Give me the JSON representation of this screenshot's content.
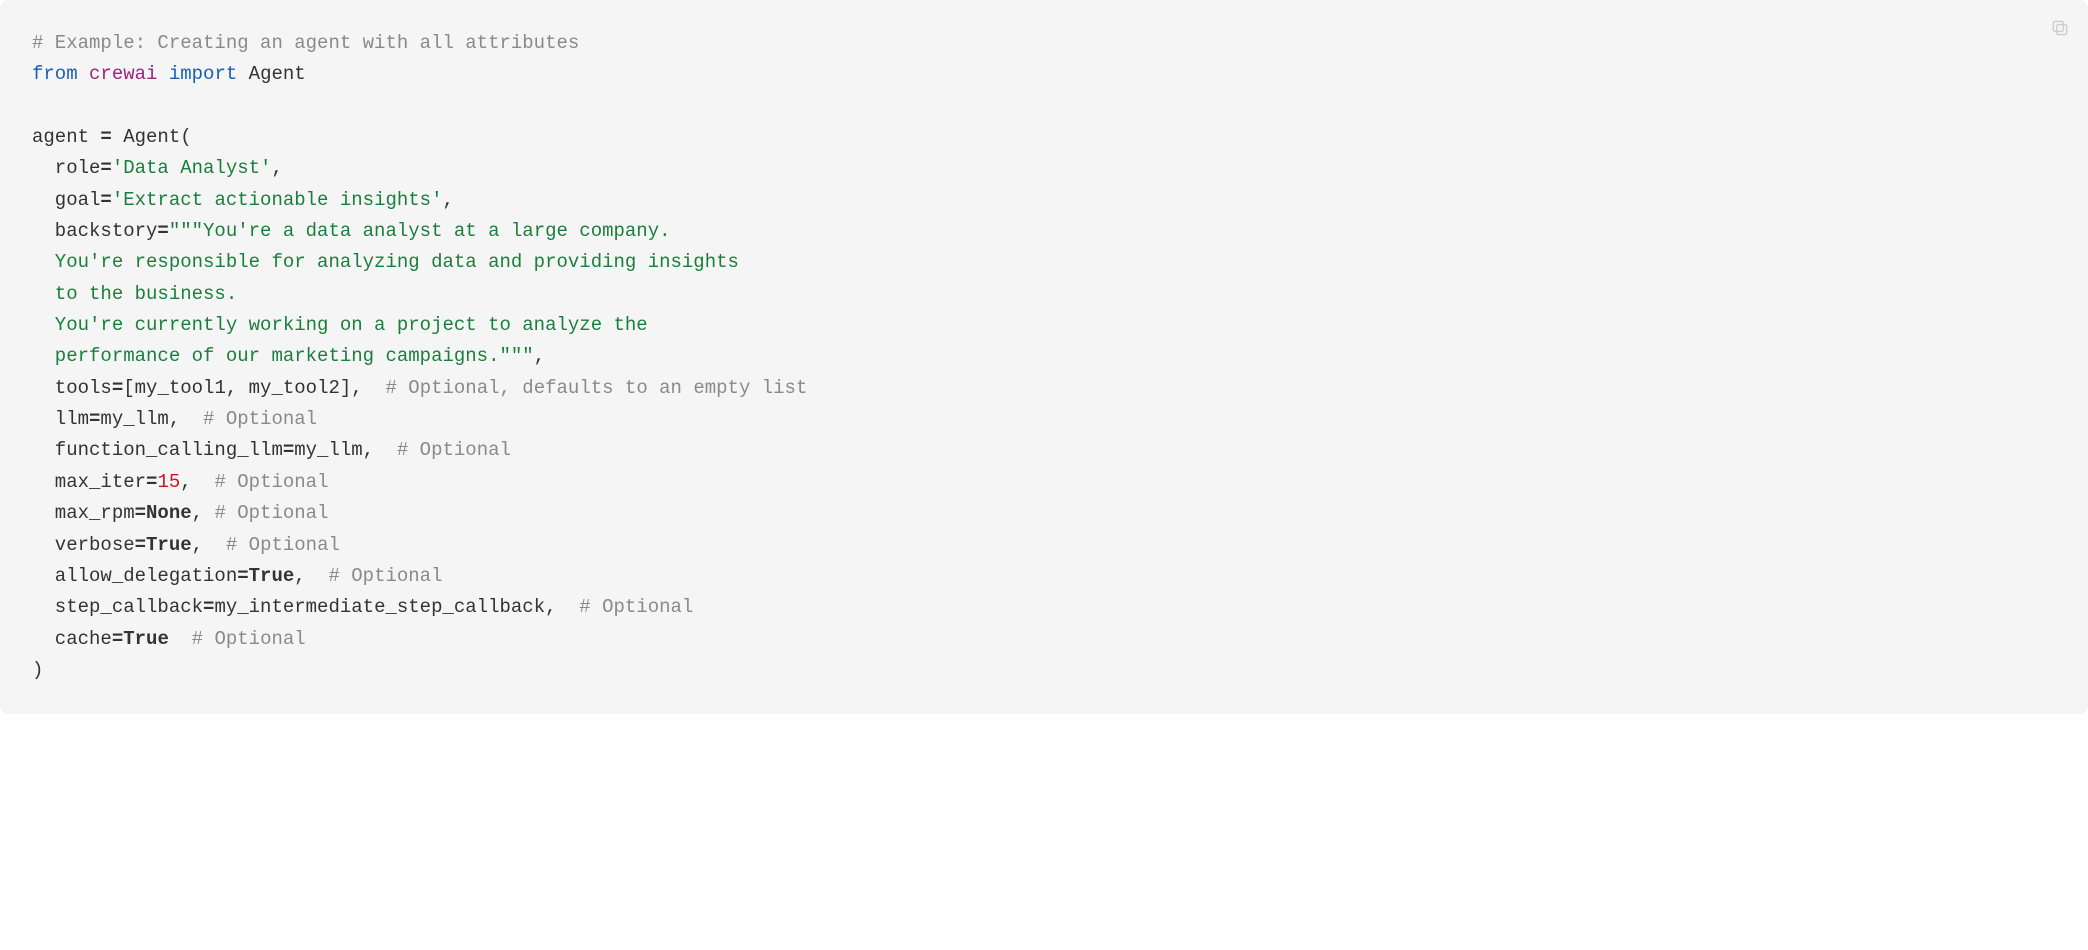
{
  "code": {
    "comment_header": "# Example: Creating an agent with all attributes",
    "kw_from": "from",
    "module": "crewai",
    "kw_import": "import",
    "import_name": "Agent",
    "assign_lhs": "agent ",
    "eq": "=",
    "ctor": " Agent(",
    "role_code": "  role",
    "role_eq": "=",
    "role_val": "'Data Analyst'",
    "role_comma": ",",
    "goal_code": "  goal",
    "goal_eq": "=",
    "goal_val": "'Extract actionable insights'",
    "goal_comma": ",",
    "backstory_code": "  backstory",
    "backstory_eq": "=",
    "backstory_l1": "\"\"\"You're a data analyst at a large company.",
    "backstory_l2": "  You're responsible for analyzing data and providing insights",
    "backstory_l3": "  to the business.",
    "backstory_l4": "  You're currently working on a project to analyze the",
    "backstory_l5": "  performance of our marketing campaigns.\"\"\"",
    "backstory_comma": ",",
    "tools_code": "  tools",
    "tools_eq": "=",
    "tools_val": "[my_tool1, my_tool2],  ",
    "tools_comment": "# Optional, defaults to an empty list",
    "llm_code": "  llm",
    "llm_eq": "=",
    "llm_val": "my_llm,  ",
    "llm_comment": "# Optional",
    "fcl_code": "  function_calling_llm",
    "fcl_eq": "=",
    "fcl_val": "my_llm,  ",
    "fcl_comment": "# Optional",
    "maxiter_code": "  max_iter",
    "maxiter_eq": "=",
    "maxiter_val": "15",
    "maxiter_rest": ",  ",
    "maxiter_comment": "# Optional",
    "maxrpm_code": "  max_rpm",
    "maxrpm_eq": "=",
    "maxrpm_val": "None",
    "maxrpm_rest": ", ",
    "maxrpm_comment": "# Optional",
    "verbose_code": "  verbose",
    "verbose_eq": "=",
    "verbose_val": "True",
    "verbose_rest": ",  ",
    "verbose_comment": "# Optional",
    "allow_code": "  allow_delegation",
    "allow_eq": "=",
    "allow_val": "True",
    "allow_rest": ",  ",
    "allow_comment": "# Optional",
    "step_code": "  step_callback",
    "step_eq": "=",
    "step_val": "my_intermediate_step_callback,  ",
    "step_comment": "# Optional",
    "cache_code": "  cache",
    "cache_eq": "=",
    "cache_val": "True",
    "cache_rest": "  ",
    "cache_comment": "# Optional",
    "close_paren": ")"
  },
  "copy_label": "Copy"
}
